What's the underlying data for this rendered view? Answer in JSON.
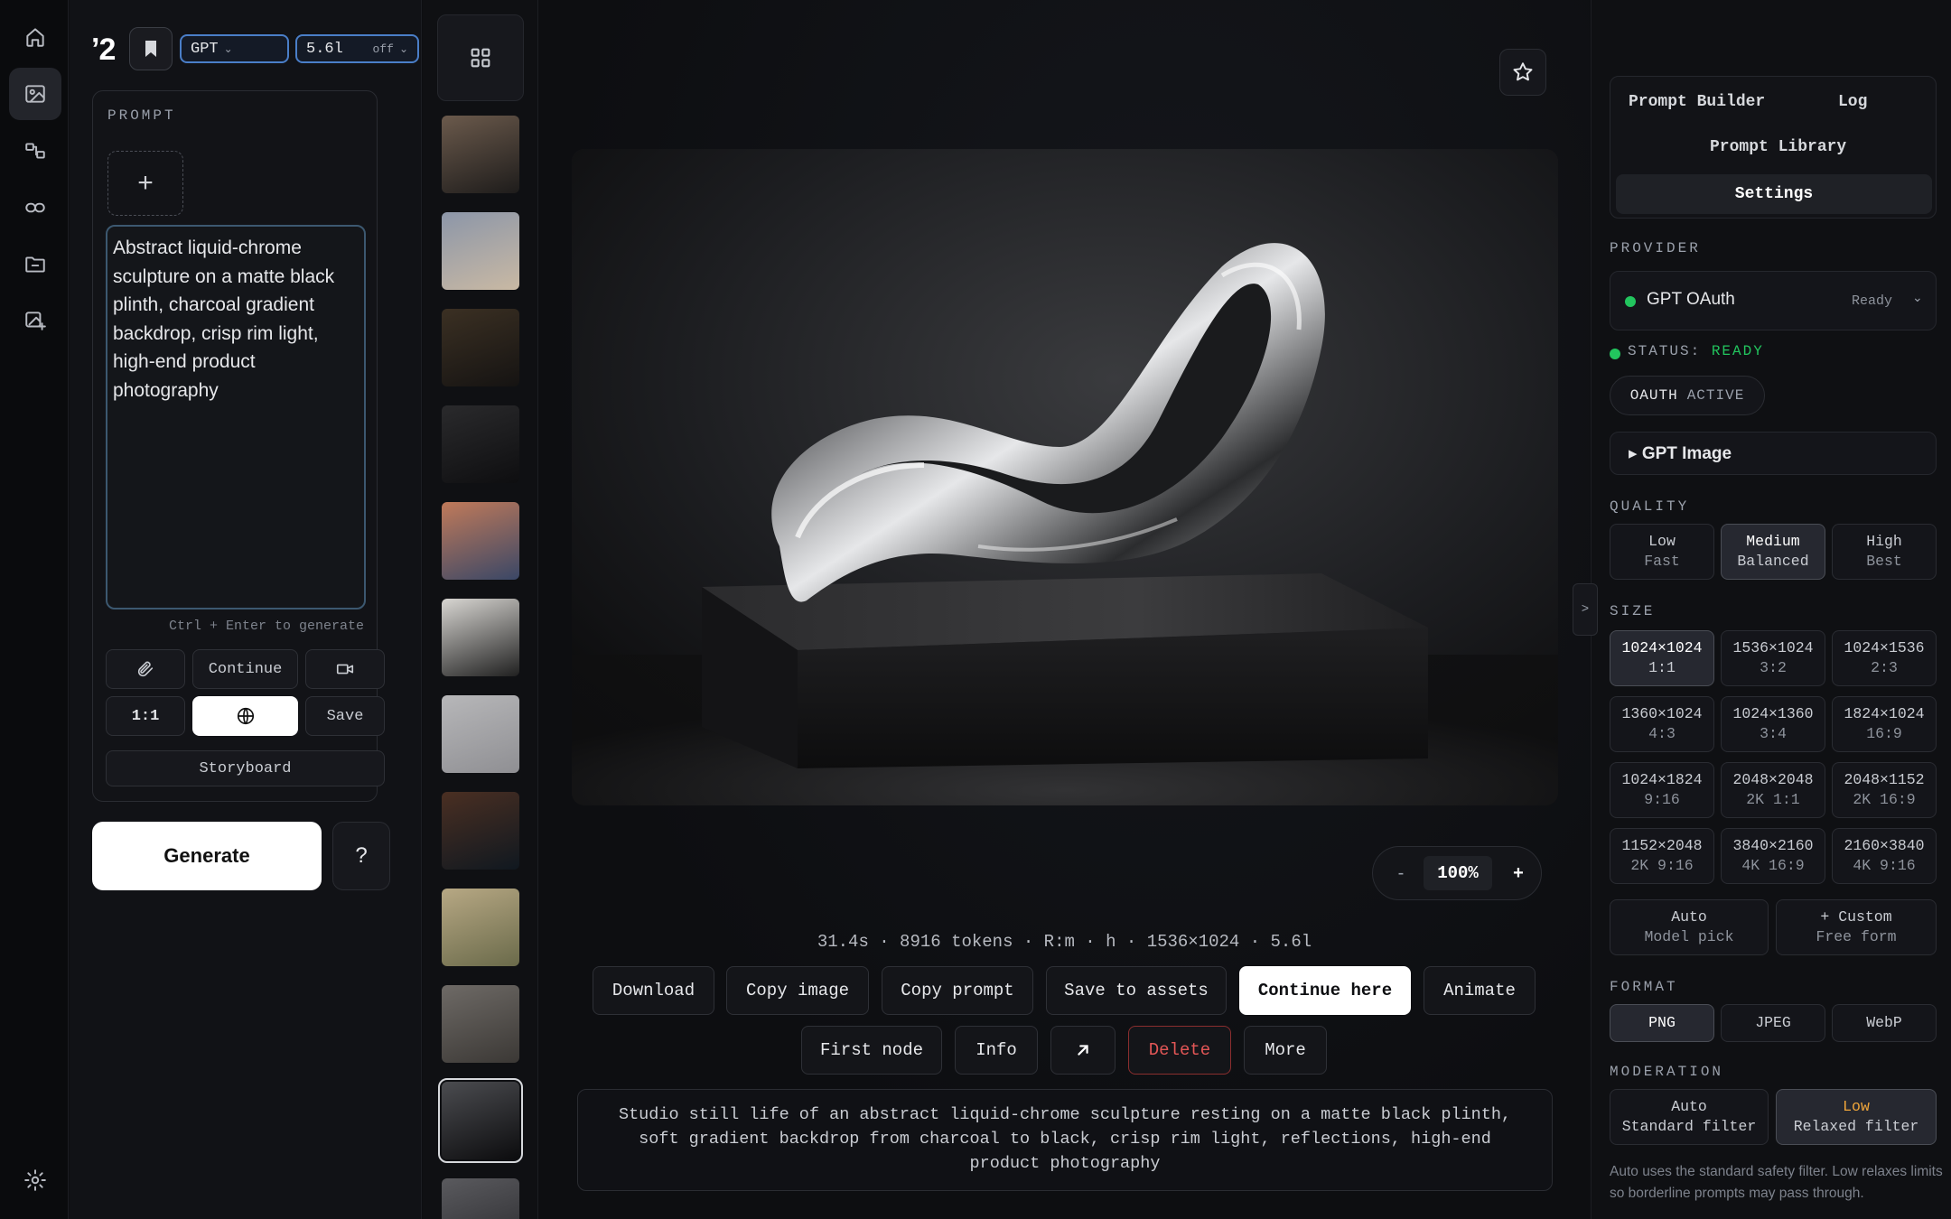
{
  "left_panel": {
    "logo": "ʼ2",
    "model_select": "GPT",
    "version_select": "5.6l",
    "version_sub": "off",
    "prompt_label": "PROMPT",
    "add_label": "+",
    "prompt_text": "Abstract liquid-chrome sculpture on a matte black plinth, charcoal gradient backdrop, crisp rim light, high-end product photography",
    "hint": "Ctrl + Enter to generate",
    "continue_label": "Continue",
    "ratio_label": "1:1",
    "save_label": "Save",
    "storyboard_label": "Storyboard",
    "generate_label": "Generate",
    "help_label": "?"
  },
  "thumbnails": [
    {
      "name": "chrome-sculpture-1",
      "colors": [
        "#6b5a4c",
        "#1e1c1b"
      ]
    },
    {
      "name": "marble-sculpture",
      "colors": [
        "#8c96a8",
        "#c9b9a4"
      ]
    },
    {
      "name": "gold-sculpture",
      "colors": [
        "#3b3023",
        "#151312"
      ]
    },
    {
      "name": "camera",
      "colors": [
        "#2a2a2c",
        "#0e0e10"
      ]
    },
    {
      "name": "mountain-lake",
      "colors": [
        "#c07a5a",
        "#3a4766"
      ]
    },
    {
      "name": "poster",
      "colors": [
        "#d8d6d2",
        "#202020"
      ]
    },
    {
      "name": "sneaker",
      "colors": [
        "#b7b7b9",
        "#8f8f93"
      ]
    },
    {
      "name": "night-street",
      "colors": [
        "#4a2f22",
        "#101820"
      ]
    },
    {
      "name": "isometric-house",
      "colors": [
        "#b7a884",
        "#6a6a4a"
      ]
    },
    {
      "name": "interior",
      "colors": [
        "#6e6a66",
        "#3b3835"
      ]
    },
    {
      "name": "chrome-sculpture-selected",
      "colors": [
        "#4b4c50",
        "#0c0c0e"
      ]
    },
    {
      "name": "white-room",
      "colors": [
        "#5a5a5e",
        "#2a2a2e"
      ]
    }
  ],
  "main": {
    "zoom_minus": "-",
    "zoom_value": "100%",
    "zoom_plus": "+",
    "stats": "31.4s · 8916 tokens · R:m · h · 1536×1024 · 5.6l",
    "actions_row1": [
      "Download",
      "Copy image",
      "Copy prompt",
      "Save to assets",
      "Continue here",
      "Animate"
    ],
    "actions_row2": [
      "First node",
      "Info",
      "",
      "Delete",
      "More"
    ],
    "caption": "Studio still life of an abstract liquid-chrome sculpture resting on a matte black plinth, soft gradient backdrop from charcoal to black, crisp rim light, reflections, high-end product photography"
  },
  "right_panel": {
    "tabs": {
      "prompt_builder": "Prompt Builder",
      "log": "Log",
      "library": "Prompt Library",
      "settings": "Settings"
    },
    "provider_label": "PROVIDER",
    "provider_name": "GPT OAuth",
    "provider_state": "Ready",
    "status_label": "STATUS:",
    "status_value": "READY",
    "oauth_a": "OAUTH",
    "oauth_b": "ACTIVE",
    "model_group": "▸ GPT Image",
    "quality_label": "QUALITY",
    "quality": [
      {
        "main": "Low",
        "sub": "Fast"
      },
      {
        "main": "Medium",
        "sub": "Balanced"
      },
      {
        "main": "High",
        "sub": "Best"
      }
    ],
    "size_label": "SIZE",
    "sizes": [
      {
        "main": "1024×1024",
        "sub": "1:1"
      },
      {
        "main": "1536×1024",
        "sub": "3:2"
      },
      {
        "main": "1024×1536",
        "sub": "2:3"
      },
      {
        "main": "1360×1024",
        "sub": "4:3"
      },
      {
        "main": "1024×1360",
        "sub": "3:4"
      },
      {
        "main": "1824×1024",
        "sub": "16:9"
      },
      {
        "main": "1024×1824",
        "sub": "9:16"
      },
      {
        "main": "2048×2048",
        "sub": "2K 1:1"
      },
      {
        "main": "2048×1152",
        "sub": "2K 16:9"
      },
      {
        "main": "1152×2048",
        "sub": "2K 9:16"
      },
      {
        "main": "3840×2160",
        "sub": "4K 16:9"
      },
      {
        "main": "2160×3840",
        "sub": "4K 9:16"
      }
    ],
    "auto_size": {
      "main": "Auto",
      "sub": "Model pick"
    },
    "custom_size": {
      "main": "+ Custom",
      "sub": "Free form"
    },
    "format_label": "FORMAT",
    "formats": [
      "PNG",
      "JPEG",
      "WebP"
    ],
    "moderation_label": "MODERATION",
    "moderation": [
      {
        "main": "Auto",
        "sub": "Standard filter"
      },
      {
        "main": "Low",
        "sub": "Relaxed filter"
      }
    ],
    "moderation_note": "Auto uses the standard safety filter. Low relaxes limits so borderline prompts may pass through.",
    "collapse_label": ">"
  },
  "colors": {
    "accent_ready": "#22c55e",
    "danger": "#e25656",
    "warn": "#f0a63a",
    "select_border": "#4a7ec8"
  }
}
